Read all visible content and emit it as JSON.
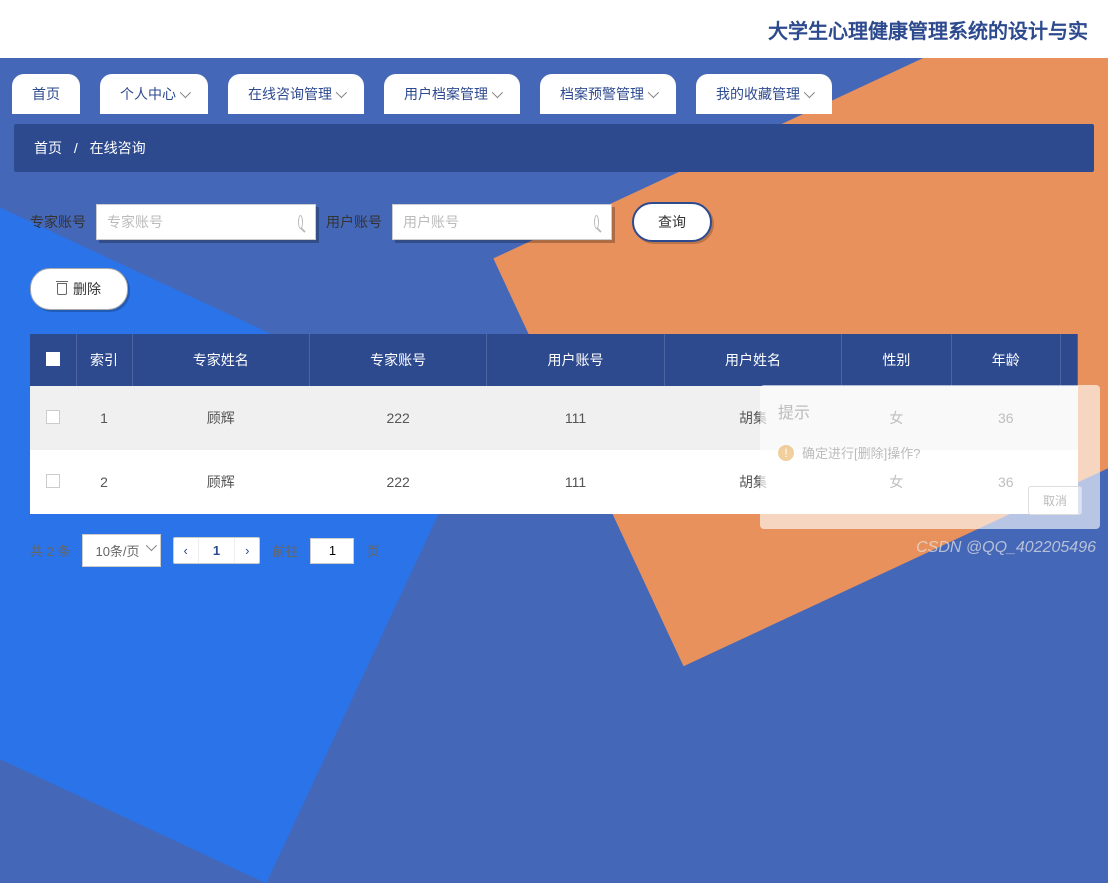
{
  "header": {
    "title": "大学生心理健康管理系统的设计与实"
  },
  "nav": [
    {
      "label": "首页",
      "dropdown": false
    },
    {
      "label": "个人中心",
      "dropdown": true
    },
    {
      "label": "在线咨询管理",
      "dropdown": true
    },
    {
      "label": "用户档案管理",
      "dropdown": true
    },
    {
      "label": "档案预警管理",
      "dropdown": true
    },
    {
      "label": "我的收藏管理",
      "dropdown": true
    }
  ],
  "breadcrumb": {
    "home": "首页",
    "current": "在线咨询"
  },
  "filters": {
    "expert_label": "专家账号",
    "expert_placeholder": "专家账号",
    "user_label": "用户账号",
    "user_placeholder": "用户账号",
    "query_btn": "查询"
  },
  "actions": {
    "delete": "删除"
  },
  "table": {
    "headers": [
      "",
      "索引",
      "专家姓名",
      "专家账号",
      "用户账号",
      "用户姓名",
      "性别",
      "年龄"
    ],
    "rows": [
      {
        "idx": "1",
        "expert_name": "顾辉",
        "expert_acc": "222",
        "user_acc": "111",
        "user_name": "胡集",
        "gender": "女",
        "age": "36"
      },
      {
        "idx": "2",
        "expert_name": "顾辉",
        "expert_acc": "222",
        "user_acc": "111",
        "user_name": "胡集",
        "gender": "女",
        "age": "36"
      }
    ]
  },
  "pagination": {
    "total": "共 2 条",
    "page_size": "10条/页",
    "current": "1",
    "jump_pre": "前往",
    "jump_val": "1",
    "jump_post": "页"
  },
  "dialog": {
    "title": "提示",
    "message": "确定进行[删除]操作?",
    "cancel": "取消"
  },
  "watermark": "CSDN @QQ_402205496"
}
